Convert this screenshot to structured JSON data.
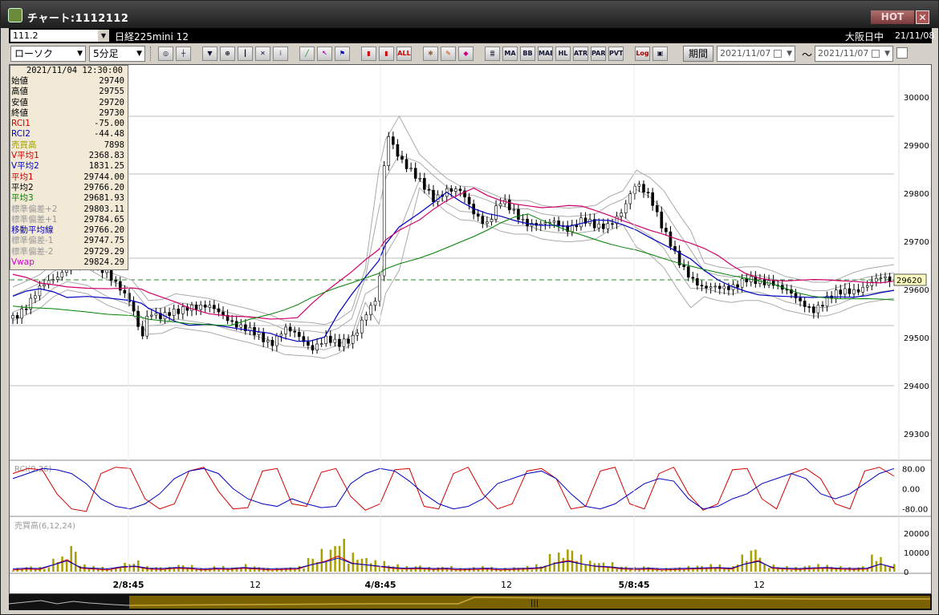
{
  "window": {
    "title": "チャート:1112112",
    "hot_label": "HOT",
    "close_label": "✕"
  },
  "symbolbar": {
    "symbol_code": "111.2",
    "product_name": "日経225mini 12",
    "market": "大阪日中",
    "date": "21/11/08"
  },
  "toolbar": {
    "chart_type": "ローソク",
    "interval": "5分足",
    "buttons": [
      "search",
      "crosshair",
      "down",
      "zoom",
      "bars",
      "fx",
      "info",
      "line",
      "arrow",
      "flag",
      "candle",
      "candle2",
      "ALL",
      "gear",
      "brush",
      "color",
      "list",
      "MA",
      "BB",
      "MAE",
      "HL",
      "ATR",
      "PAR",
      "PVT",
      "Log",
      "save"
    ],
    "button_labels": {
      "all": "ALL",
      "ma": "MA",
      "bb": "BB",
      "mae": "MAE",
      "hl": "HL",
      "atr": "ATR",
      "par": "PAR",
      "pvt": "PVT",
      "log": "Log"
    },
    "period_label": "期間",
    "from_date": "2021/11/07",
    "to_date": "2021/11/07",
    "tilde": "～"
  },
  "infobox": {
    "timestamp": "2021/11/04  12:30:00",
    "rows": [
      {
        "label": "始値",
        "value": "29740",
        "color": "#000000"
      },
      {
        "label": "高値",
        "value": "29755",
        "color": "#000000"
      },
      {
        "label": "安値",
        "value": "29720",
        "color": "#000000"
      },
      {
        "label": "終値",
        "value": "29730",
        "color": "#000000"
      },
      {
        "label": "RCI1",
        "value": "-75.00",
        "color": "#d00000"
      },
      {
        "label": "RCI2",
        "value": "-44.48",
        "color": "#0000c0"
      },
      {
        "label": "売買高",
        "value": "7898",
        "color": "#a0a000"
      },
      {
        "label": "V平均1",
        "value": "2368.83",
        "color": "#d00000"
      },
      {
        "label": "V平均2",
        "value": "1831.25",
        "color": "#0000c0"
      },
      {
        "label": "平均1",
        "value": "29744.00",
        "color": "#d00000"
      },
      {
        "label": "平均2",
        "value": "29766.20",
        "color": "#000000"
      },
      {
        "label": "平均3",
        "value": "29681.93",
        "color": "#008000"
      },
      {
        "label": "標準偏差+2",
        "value": "29803.11",
        "color": "#999999"
      },
      {
        "label": "標準偏差+1",
        "value": "29784.65",
        "color": "#999999"
      },
      {
        "label": "移動平均線",
        "value": "29766.20",
        "color": "#0000c0"
      },
      {
        "label": "標準偏差-1",
        "value": "29747.75",
        "color": "#999999"
      },
      {
        "label": "標準偏差-2",
        "value": "29729.29",
        "color": "#999999"
      },
      {
        "label": "Vwap",
        "value": "29824.29",
        "color": "#d000d0"
      }
    ]
  },
  "price_axis": {
    "ticks": [
      "30000",
      "29900",
      "29800",
      "29700",
      "29600",
      "29500",
      "29400",
      "29300"
    ],
    "current_price": "29620"
  },
  "rci_panel": {
    "label": "RCI(9,26)",
    "ticks": [
      "80.00",
      "0.00",
      "-80.00"
    ]
  },
  "volume_panel": {
    "label": "売買高(6,12,24)",
    "ticks": [
      "20000",
      "10000",
      "0"
    ]
  },
  "time_axis": {
    "labels": [
      "2/8:45",
      "12",
      "4/8:45",
      "12",
      "5/8:45",
      "12"
    ]
  },
  "chart_data": {
    "type": "candlestick",
    "title": "",
    "y_range": [
      29250,
      30050
    ],
    "price_path": [
      [
        0,
        29540
      ],
      [
        10,
        29570
      ],
      [
        20,
        29600
      ],
      [
        30,
        29620
      ],
      [
        40,
        29650
      ],
      [
        55,
        29660
      ],
      [
        70,
        29640
      ],
      [
        88,
        29560
      ],
      [
        95,
        29500
      ],
      [
        100,
        29560
      ],
      [
        110,
        29540
      ],
      [
        120,
        29550
      ],
      [
        130,
        29570
      ],
      [
        145,
        29560
      ],
      [
        160,
        29540
      ],
      [
        175,
        29510
      ],
      [
        190,
        29490
      ],
      [
        200,
        29520
      ],
      [
        210,
        29500
      ],
      [
        220,
        29480
      ],
      [
        230,
        29500
      ],
      [
        240,
        29480
      ],
      [
        250,
        29500
      ],
      [
        260,
        29550
      ],
      [
        270,
        29580
      ],
      [
        275,
        29930
      ],
      [
        285,
        29880
      ],
      [
        300,
        29820
      ],
      [
        310,
        29790
      ],
      [
        320,
        29810
      ],
      [
        330,
        29800
      ],
      [
        340,
        29760
      ],
      [
        350,
        29740
      ],
      [
        360,
        29780
      ],
      [
        370,
        29760
      ],
      [
        380,
        29740
      ],
      [
        390,
        29730
      ],
      [
        400,
        29740
      ],
      [
        410,
        29730
      ],
      [
        420,
        29740
      ],
      [
        430,
        29730
      ],
      [
        440,
        29740
      ],
      [
        450,
        29760
      ],
      [
        460,
        29820
      ],
      [
        470,
        29800
      ],
      [
        480,
        29720
      ],
      [
        490,
        29660
      ],
      [
        500,
        29630
      ],
      [
        510,
        29600
      ],
      [
        520,
        29600
      ],
      [
        530,
        29610
      ],
      [
        540,
        29620
      ],
      [
        550,
        29610
      ],
      [
        560,
        29620
      ],
      [
        570,
        29600
      ],
      [
        580,
        29570
      ],
      [
        590,
        29560
      ],
      [
        600,
        29580
      ],
      [
        610,
        29590
      ],
      [
        620,
        29600
      ],
      [
        630,
        29610
      ],
      [
        640,
        29620
      ],
      [
        650,
        29620
      ]
    ],
    "rci_range": [
      -100,
      100
    ],
    "rci1": [
      60,
      80,
      75,
      -20,
      -80,
      -90,
      60,
      85,
      80,
      -40,
      -80,
      -60,
      70,
      85,
      -10,
      -80,
      -75,
      70,
      80,
      -60,
      -70,
      65,
      80,
      -30,
      -85,
      -60,
      75,
      80,
      -70,
      -80,
      60,
      85,
      -20,
      -80,
      -60,
      70,
      80,
      40,
      -80,
      -70,
      70,
      85,
      -60,
      -80,
      60,
      85,
      -20,
      -85,
      -60,
      75,
      80,
      -40,
      -80,
      60,
      80,
      40,
      -60,
      -80,
      70,
      85,
      50
    ],
    "rci2": [
      40,
      60,
      80,
      75,
      60,
      20,
      -40,
      -70,
      -80,
      -60,
      -20,
      40,
      70,
      80,
      60,
      0,
      -40,
      -60,
      -70,
      -40,
      -60,
      -75,
      -70,
      20,
      60,
      80,
      70,
      30,
      -20,
      -60,
      -80,
      -70,
      -40,
      20,
      40,
      60,
      70,
      40,
      -20,
      -70,
      -80,
      -60,
      -20,
      20,
      40,
      30,
      -40,
      -80,
      -70,
      -40,
      -20,
      20,
      40,
      60,
      40,
      -20,
      -40,
      -20,
      20,
      60,
      80
    ],
    "volume_range": [
      0,
      25000
    ],
    "volume": [
      2000,
      3000,
      2500,
      8000,
      14000,
      4000,
      3000,
      2000,
      5000,
      6000,
      3000,
      2500,
      4000,
      3500,
      2000,
      3000,
      2500,
      4000,
      3000,
      2000,
      2500,
      3000,
      8000,
      12000,
      18000,
      10000,
      8000,
      6000,
      4000,
      3000,
      3500,
      2500,
      3000,
      2000,
      2500,
      3000,
      2000,
      2500,
      3000,
      4000,
      10000,
      13000,
      9000,
      6000,
      5000,
      3000,
      2500,
      3000,
      2000,
      2500,
      3000,
      3500,
      4000,
      3000,
      9000,
      13000,
      4000,
      3000,
      2500,
      3500,
      4000,
      3000,
      2500,
      3000,
      9000,
      4000
    ],
    "series": [
      {
        "name": "平均1",
        "color": "#d0006a"
      },
      {
        "name": "平均2",
        "color": "#0000c0"
      },
      {
        "name": "平均3",
        "color": "#008000"
      },
      {
        "name": "標準偏差",
        "color": "#aaaaaa"
      }
    ]
  }
}
